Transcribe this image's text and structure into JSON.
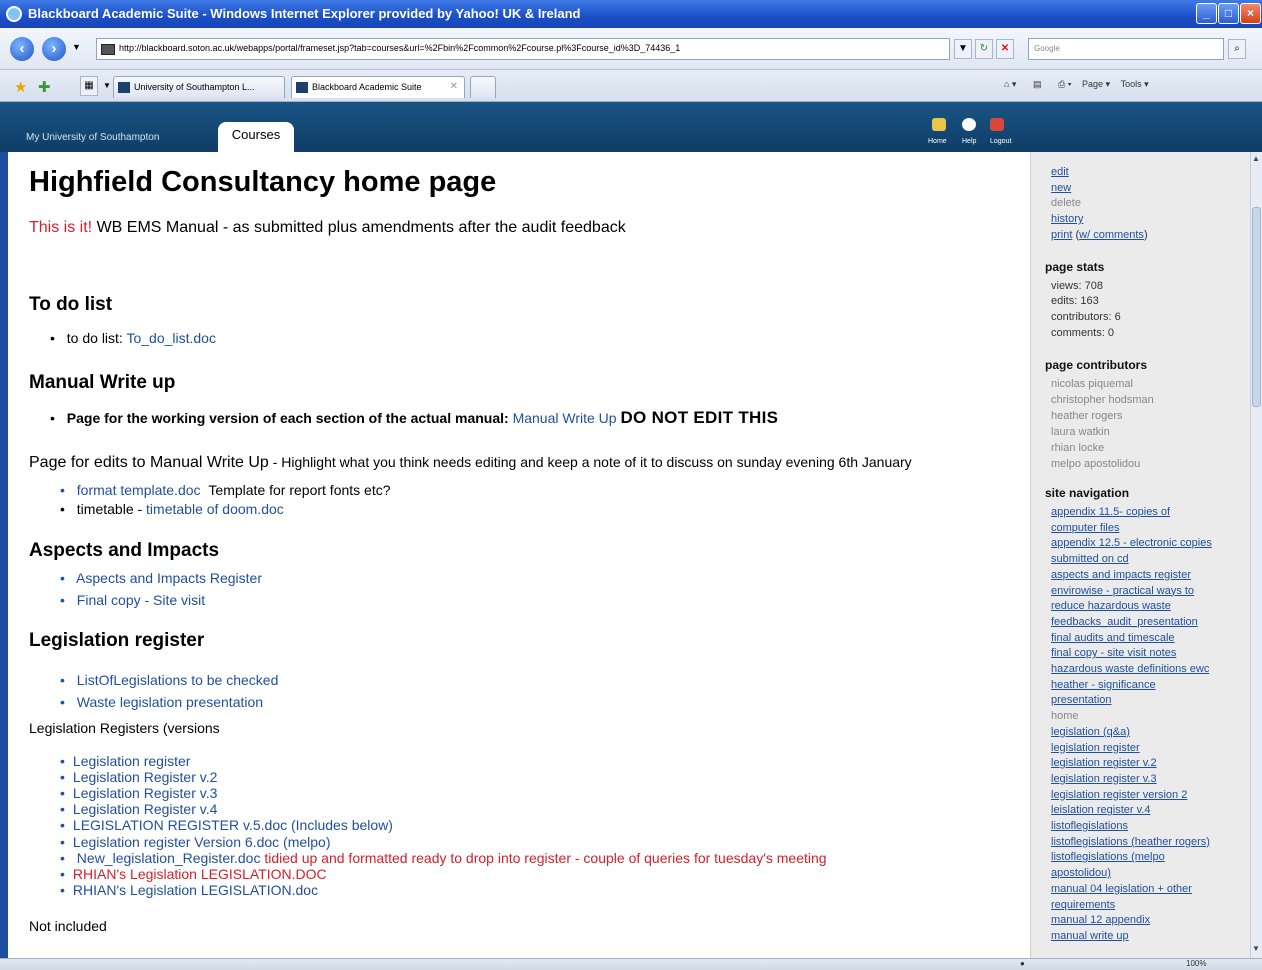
{
  "browser": {
    "window_title": "Blackboard Academic Suite - Windows Internet Explorer provided by Yahoo! UK & Ireland",
    "url": "http://blackboard.soton.ac.uk/webapps/portal/frameset.jsp?tab=courses&url=%2Fbin%2Fcommon%2Fcourse.pl%3Fcourse_id%3D_74436_1",
    "search_placeholder": "Google",
    "tabs": [
      {
        "label": "University of Southampton L..."
      },
      {
        "label": "Blackboard Academic Suite"
      }
    ],
    "tools": {
      "page": "Page",
      "tools": "Tools"
    },
    "status_zoom": "100%"
  },
  "header": {
    "my_tab": "My University of Southampton",
    "courses_tab": "Courses",
    "home": "Home",
    "help": "Help",
    "logout": "Logout"
  },
  "content": {
    "title": "Highfield Consultancy home page",
    "intro_highlight": "This is it!",
    "intro_text": "WB EMS Manual - as submitted plus amendments after the audit feedback",
    "todo": {
      "heading": "To do list",
      "item_prefix": "to do list: ",
      "item_link": "To_do_list.doc"
    },
    "manual": {
      "heading": "Manual Write up",
      "bold_prefix": "Page for the working version of each section of the actual manual:",
      "link": "Manual Write Up",
      "warning": "DO NOT EDIT THIS",
      "edits_main": "Page for edits to Manual Write Up",
      "edits_rest": " - Highlight what you think needs editing and keep a note of it to discuss on sunday evening 6th January",
      "format_link": "format template.doc",
      "format_text": "Template for report fonts etc?",
      "timetable_prefix": "timetable - ",
      "timetable_link": "timetable of doom.doc"
    },
    "aspects": {
      "heading": "Aspects and Impacts",
      "items": [
        "Aspects and Impacts Register",
        "Final copy - Site visit"
      ]
    },
    "legislation": {
      "heading": "Legislation register",
      "items": [
        "ListOfLegislations to be checked",
        "Waste legislation presentation"
      ],
      "registers_label": "Legislation Registers (versions",
      "versions": [
        "Legislation register",
        "Legislation Register v.2",
        "Legislation Register v.3",
        "Legislation Register v.4",
        "LEGISLATION REGISTER v.5.doc (Includes below)",
        "Legislation register Version 6.doc (melpo)"
      ],
      "new_link": "New_legislation_Register.doc",
      "new_note": " tidied up and formatted ready to drop into register - couple of queries for tuesday's meeting",
      "rhian_red": "RHIAN's Legislation  LEGISLATION.DOC",
      "rhian_blue": "RHIAN's Legislation LEGISLATION.doc",
      "not_included": "Not included"
    }
  },
  "sidebar": {
    "actions": [
      "edit",
      "new",
      "delete",
      "history"
    ],
    "print": "print",
    "print_comments": "w/ comments",
    "stats_heading": "page stats",
    "stats": [
      "views: 708",
      "edits: 163",
      "contributors: 6",
      "comments: 0"
    ],
    "contributors_heading": "page contributors",
    "contributors": [
      "nicolas piquemal",
      "christopher hodsman",
      "heather rogers",
      "laura watkin",
      "rhian locke",
      "melpo apostolidou"
    ],
    "nav_heading": "site navigation",
    "nav": [
      "appendix 11.5- copies of",
      "computer files",
      "appendix 12.5 - electronic copies",
      "submitted on cd",
      "aspects and impacts register",
      "envirowise - practical ways to",
      "reduce hazardous waste",
      "feedbacks_audit_presentation",
      "final audits and timescale",
      "final copy - site visit notes",
      "hazardous waste definitions ewc",
      "heather - significance",
      "presentation",
      "home",
      "legislation (q&a)",
      "legislation register",
      "legislation register v.2",
      "legislation register v.3",
      "legislation register version 2",
      "leislation register v.4",
      "listoflegislations",
      "listoflegislations (heather rogers)",
      "listoflegislations (melpo",
      "apostolidou)",
      "manual 04 legislation + other",
      "requirements",
      "manual 12 appendix",
      "manual write up"
    ]
  }
}
